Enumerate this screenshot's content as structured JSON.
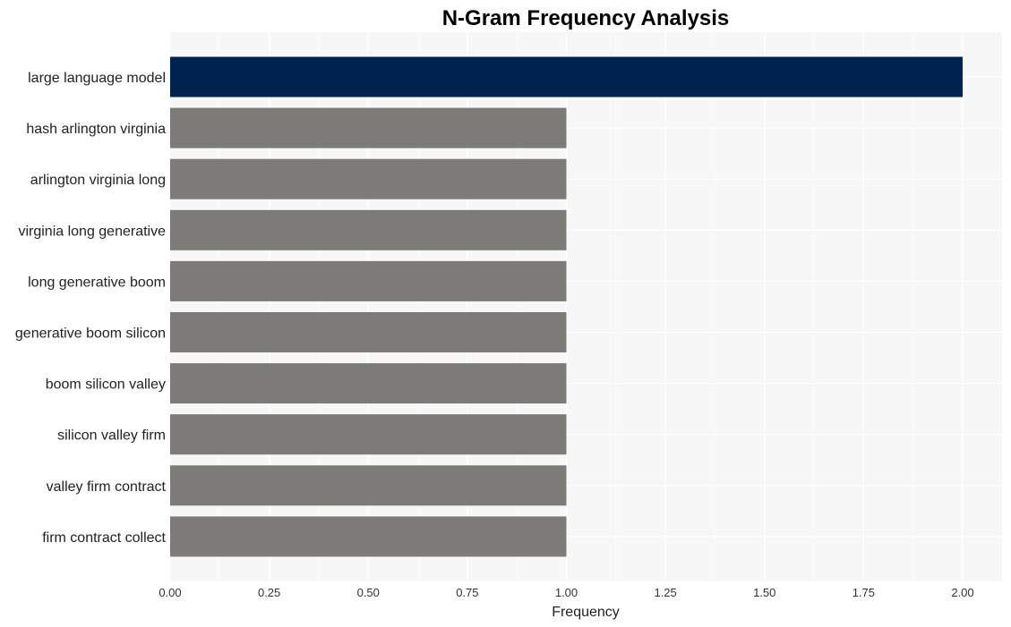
{
  "chart_data": {
    "type": "bar",
    "orientation": "horizontal",
    "title": "N-Gram Frequency Analysis",
    "xlabel": "Frequency",
    "ylabel": "",
    "xlim": [
      0,
      2.1
    ],
    "grid": true,
    "xticks": [
      "0.00",
      "0.25",
      "0.50",
      "0.75",
      "1.00",
      "1.25",
      "1.50",
      "1.75",
      "2.00"
    ],
    "xtick_values": [
      0,
      0.25,
      0.5,
      0.75,
      1.0,
      1.25,
      1.5,
      1.75,
      2.0
    ],
    "categories": [
      "large language model",
      "hash arlington virginia",
      "arlington virginia long",
      "virginia long generative",
      "long generative boom",
      "generative boom silicon",
      "boom silicon valley",
      "silicon valley firm",
      "valley firm contract",
      "firm contract collect"
    ],
    "values": [
      2,
      1,
      1,
      1,
      1,
      1,
      1,
      1,
      1,
      1
    ],
    "colors": {
      "highlight": "#00224e",
      "default": "#7c7b78",
      "plot_background": "#f7f7f7",
      "grid": "#ffffff"
    }
  }
}
